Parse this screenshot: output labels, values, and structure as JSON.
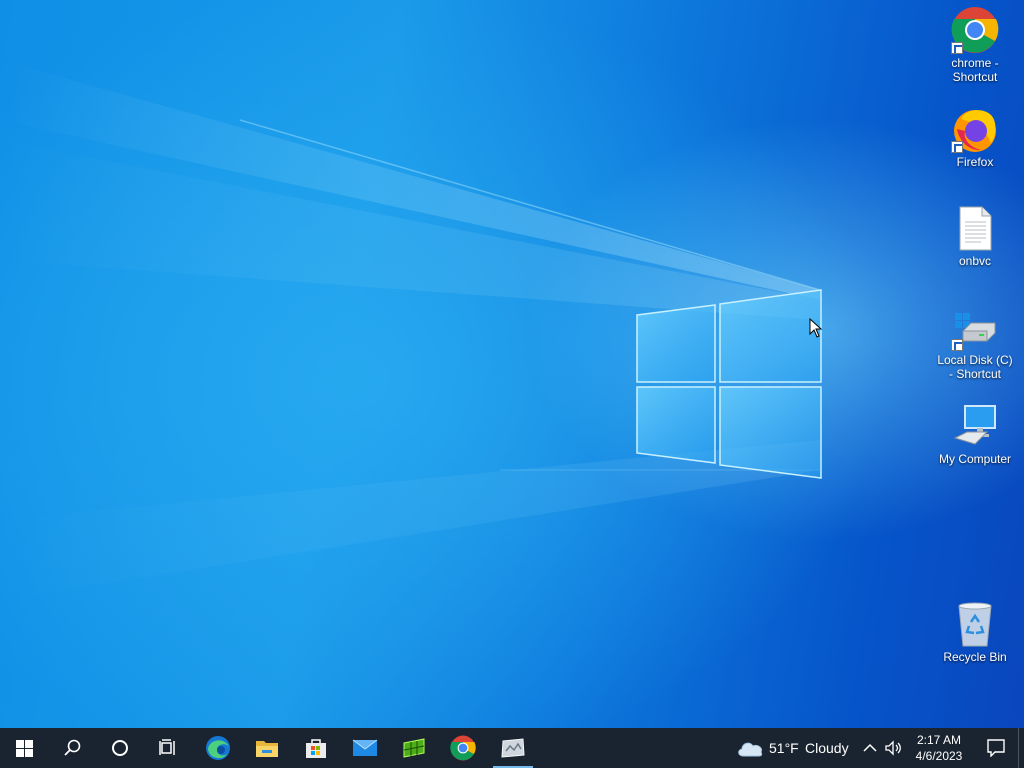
{
  "desktop": {
    "icons": [
      {
        "label": "chrome - Shortcut",
        "icon": "chrome-icon"
      },
      {
        "label": "Firefox",
        "icon": "firefox-icon"
      },
      {
        "label": "onbvc",
        "icon": "text-file-icon"
      },
      {
        "label": "Local Disk (C) - Shortcut",
        "icon": "drive-icon"
      },
      {
        "label": "My Computer",
        "icon": "computer-icon"
      },
      {
        "label": "Recycle Bin",
        "icon": "recycle-bin-icon"
      }
    ]
  },
  "taskbar": {
    "pinned": [
      {
        "name": "start-button",
        "icon": "windows-logo-icon"
      },
      {
        "name": "search-button",
        "icon": "search-icon"
      },
      {
        "name": "cortana-button",
        "icon": "cortana-icon"
      },
      {
        "name": "task-view-button",
        "icon": "task-view-icon"
      },
      {
        "name": "edge-button",
        "icon": "edge-icon"
      },
      {
        "name": "file-explorer-button",
        "icon": "folder-icon"
      },
      {
        "name": "store-button",
        "icon": "store-icon"
      },
      {
        "name": "mail-button",
        "icon": "mail-icon"
      },
      {
        "name": "app-button",
        "icon": "green-app-icon"
      },
      {
        "name": "chrome-button",
        "icon": "chrome-icon"
      },
      {
        "name": "running-app-button",
        "icon": "app-window-icon"
      }
    ],
    "weather": {
      "temp": "51°F",
      "condition": "Cloudy"
    },
    "clock": {
      "time": "2:17 AM",
      "date": "4/6/2023"
    }
  },
  "colors": {
    "taskbar": "#1a2430",
    "accent": "#76b9ed",
    "desktop": "#0a6fd8"
  }
}
